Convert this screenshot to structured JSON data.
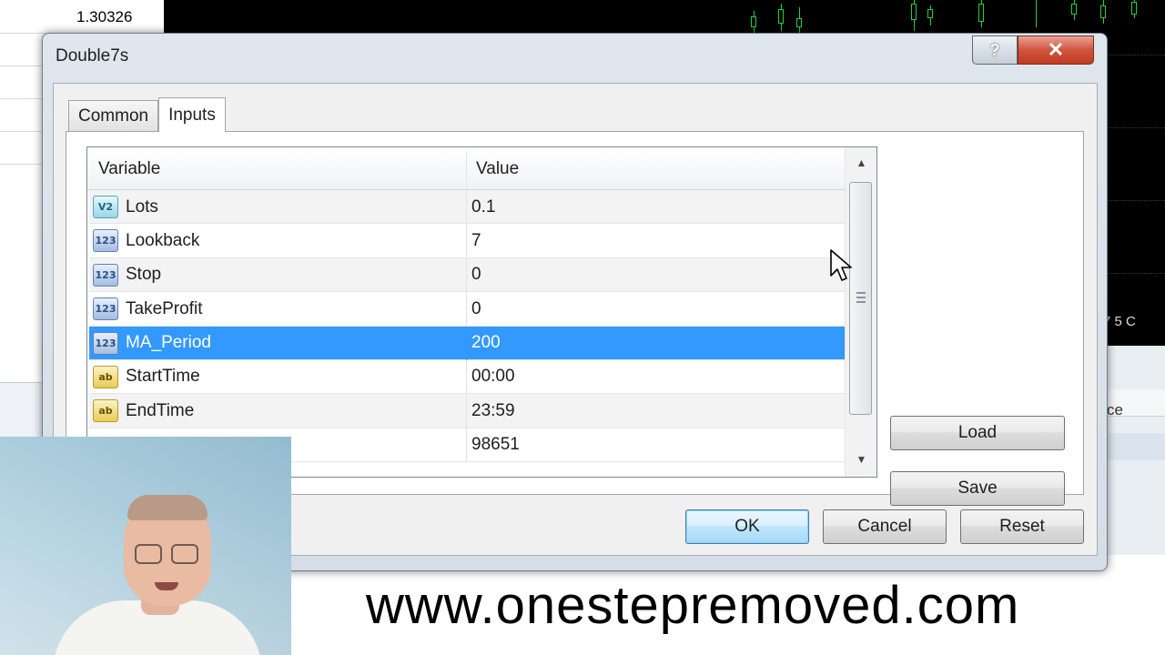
{
  "background": {
    "price_label": "1.30326",
    "axis_fragment": "7   5 C",
    "panel_fragment": "ce"
  },
  "dialog": {
    "title": "Double7s",
    "help_label": "?",
    "close_label": "✕",
    "tabs": [
      {
        "label": "Common",
        "active": false
      },
      {
        "label": "Inputs",
        "active": true
      }
    ],
    "grid": {
      "columns": [
        "Variable",
        "Value"
      ],
      "rows": [
        {
          "icon": "V2",
          "type": "double",
          "variable": "Lots",
          "value": "0.1"
        },
        {
          "icon": "123",
          "type": "int",
          "variable": "Lookback",
          "value": "7"
        },
        {
          "icon": "123",
          "type": "int",
          "variable": "Stop",
          "value": "0"
        },
        {
          "icon": "123",
          "type": "int",
          "variable": "TakeProfit",
          "value": "0"
        },
        {
          "icon": "123",
          "type": "int",
          "variable": "MA_Period",
          "value": "200",
          "selected": true
        },
        {
          "icon": "ab",
          "type": "string",
          "variable": "StartTime",
          "value": "00:00"
        },
        {
          "icon": "ab",
          "type": "string",
          "variable": "EndTime",
          "value": "23:59"
        },
        {
          "icon": "123",
          "type": "int",
          "variable": "",
          "value": "98651",
          "partial": true
        }
      ],
      "scroll_up_icon": "▲",
      "scroll_down_icon": "▼"
    },
    "side_buttons": {
      "load": "Load",
      "save": "Save"
    },
    "footer_buttons": {
      "ok": "OK",
      "cancel": "Cancel",
      "reset": "Reset"
    }
  },
  "watermark": "www.onestepremoved.com",
  "colors": {
    "selection": "#3399ff",
    "chart_bg": "#000000",
    "candle": "#20d040",
    "close_button": "#c9412a"
  }
}
